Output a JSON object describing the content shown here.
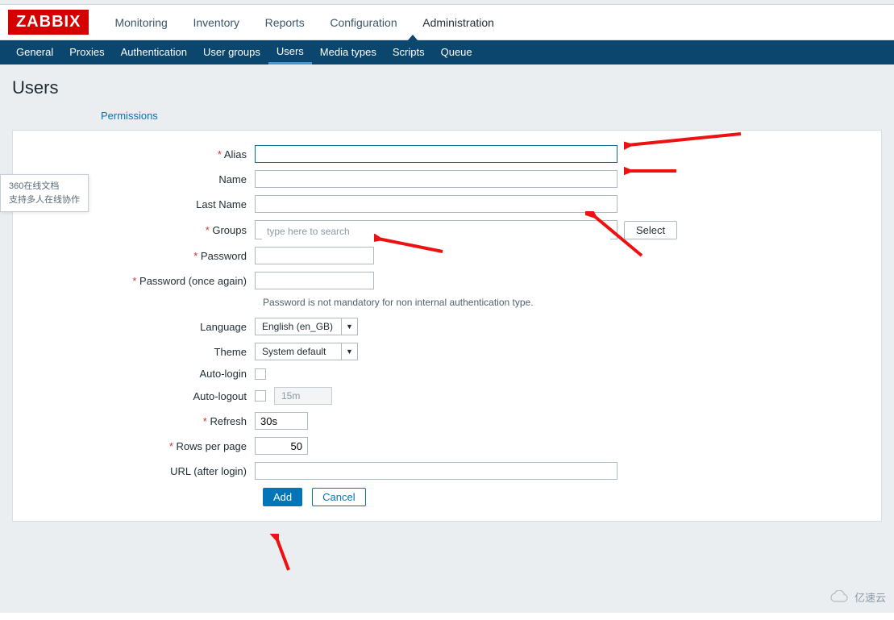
{
  "logo": "ZABBIX",
  "main_nav": {
    "monitoring": "Monitoring",
    "inventory": "Inventory",
    "reports": "Reports",
    "configuration": "Configuration",
    "administration": "Administration"
  },
  "sub_nav": {
    "general": "General",
    "proxies": "Proxies",
    "authentication": "Authentication",
    "user_groups": "User groups",
    "users": "Users",
    "media_types": "Media types",
    "scripts": "Scripts",
    "queue": "Queue"
  },
  "page": {
    "title": "Users",
    "tab_permissions": "Permissions"
  },
  "form": {
    "labels": {
      "alias": "Alias",
      "name": "Name",
      "last_name": "Last Name",
      "groups": "Groups",
      "password": "Password",
      "password_again": "Password (once again)",
      "language": "Language",
      "theme": "Theme",
      "auto_login": "Auto-login",
      "auto_logout": "Auto-logout",
      "refresh": "Refresh",
      "rows_per_page": "Rows per page",
      "url_after_login": "URL (after login)"
    },
    "values": {
      "alias": "",
      "name": "",
      "last_name": "",
      "groups_placeholder": "type here to search",
      "password": "",
      "password_again": "",
      "language": "English (en_GB)",
      "theme": "System default",
      "auto_logout_value": "15m",
      "refresh": "30s",
      "rows_per_page": "50",
      "url_after_login": ""
    },
    "note": "Password is not mandatory for non internal authentication type.",
    "select_button": "Select",
    "add_button": "Add",
    "cancel_button": "Cancel"
  },
  "overlay": {
    "line1": "360在线文档",
    "line2": "支持多人在线协作"
  },
  "footer_brand": "亿速云"
}
